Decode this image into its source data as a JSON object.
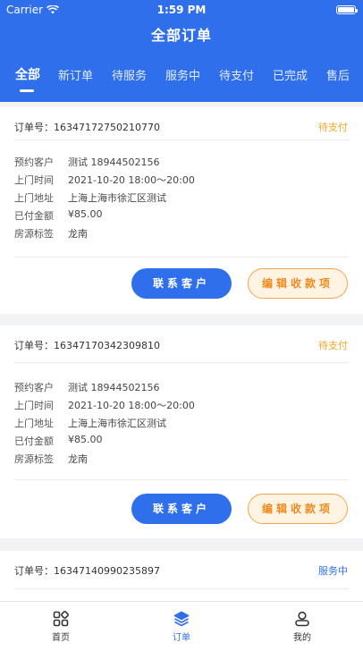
{
  "status_bar": {
    "carrier": "Carrier",
    "time": "1:59 PM",
    "battery_level": 1.0
  },
  "header": {
    "title": "全部订单"
  },
  "tabs": [
    {
      "label": "全部",
      "active": true
    },
    {
      "label": "新订单",
      "active": false
    },
    {
      "label": "待服务",
      "active": false
    },
    {
      "label": "服务中",
      "active": false
    },
    {
      "label": "待支付",
      "active": false
    },
    {
      "label": "已完成",
      "active": false
    },
    {
      "label": "售后",
      "active": false
    }
  ],
  "labels": {
    "order_prefix": "订单号：",
    "customer": "预约客户",
    "visit_time": "上门时间",
    "address": "上门地址",
    "paid_amount": "已付金额",
    "tag": "房源标签"
  },
  "buttons": {
    "contact": "联系客户",
    "edit_payment": "编辑收款项"
  },
  "orders": [
    {
      "order_no": "16347172750210770",
      "status": "待支付",
      "customer": "测试  18944502156",
      "visit_time": "2021-10-20 18:00～20:00",
      "address": "上海上海市徐汇区测试",
      "paid_amount": "¥85.00",
      "tag": "龙南"
    },
    {
      "order_no": "16347170342309810",
      "status": "待支付",
      "customer": "测试  18944502156",
      "visit_time": "2021-10-20 18:00～20:00",
      "address": "上海上海市徐汇区测试",
      "paid_amount": "¥85.00",
      "tag": "龙南"
    },
    {
      "order_no": "16347140990235897",
      "status": "服务中"
    }
  ],
  "colors": {
    "primary": "#2f6fec",
    "status_pending_pay": "#f5a623",
    "status_in_service": "#2f6fec"
  },
  "bottom_nav": [
    {
      "label": "首页",
      "icon": "grid-icon",
      "active": false
    },
    {
      "label": "订单",
      "icon": "layers-icon",
      "active": true
    },
    {
      "label": "我的",
      "icon": "user-icon",
      "active": false
    }
  ]
}
